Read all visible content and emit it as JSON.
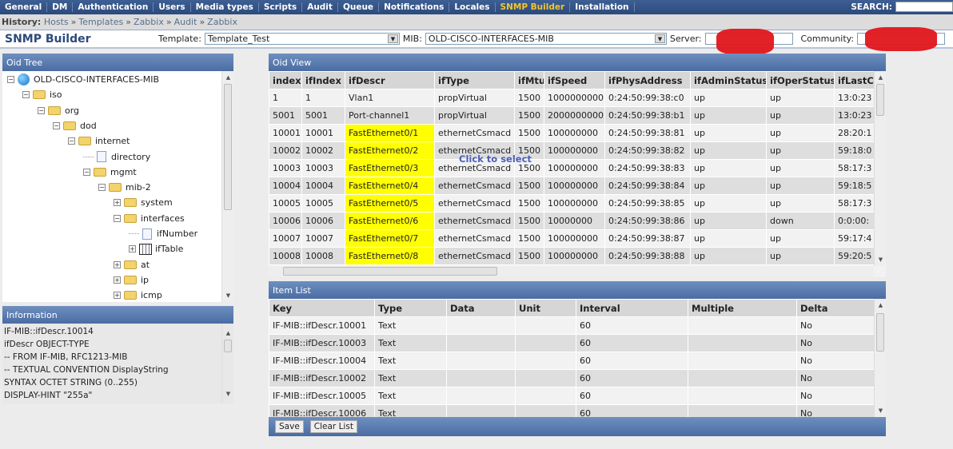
{
  "nav": {
    "items": [
      "General",
      "DM",
      "Authentication",
      "Users",
      "Media types",
      "Scripts",
      "Audit",
      "Queue",
      "Notifications",
      "Locales",
      "SNMP Builder",
      "Installation"
    ],
    "active": "SNMP Builder",
    "search_label": "SEARCH:"
  },
  "history": {
    "label": "History:",
    "crumbs": [
      "Hosts",
      "Templates",
      "Zabbix",
      "Audit",
      "Zabbix"
    ],
    "sep": "»"
  },
  "builder": {
    "title": "SNMP Builder",
    "template_label": "Template:",
    "template_value": "Template_Test",
    "mib_label": "MIB:",
    "mib_value": "OLD-CISCO-INTERFACES-MIB",
    "server_label": "Server:",
    "community_label": "Community:"
  },
  "oid_tree": {
    "title": "Oid Tree",
    "nodes": [
      {
        "label": "OLD-CISCO-INTERFACES-MIB",
        "icon": "globe",
        "exp": "-",
        "depth": 0
      },
      {
        "label": "iso",
        "icon": "folder",
        "exp": "-",
        "depth": 1
      },
      {
        "label": "org",
        "icon": "folder",
        "exp": "-",
        "depth": 2
      },
      {
        "label": "dod",
        "icon": "folder",
        "exp": "-",
        "depth": 3
      },
      {
        "label": "internet",
        "icon": "folder",
        "exp": "-",
        "depth": 4
      },
      {
        "label": "directory",
        "icon": "doc",
        "exp": "",
        "depth": 5
      },
      {
        "label": "mgmt",
        "icon": "folder",
        "exp": "-",
        "depth": 5
      },
      {
        "label": "mib-2",
        "icon": "folder",
        "exp": "-",
        "depth": 6
      },
      {
        "label": "system",
        "icon": "folder",
        "exp": "+",
        "depth": 7
      },
      {
        "label": "interfaces",
        "icon": "folder",
        "exp": "-",
        "depth": 7
      },
      {
        "label": "ifNumber",
        "icon": "doc",
        "exp": "",
        "depth": 8
      },
      {
        "label": "ifTable",
        "icon": "table",
        "exp": "+",
        "depth": 8
      },
      {
        "label": "at",
        "icon": "folder",
        "exp": "+",
        "depth": 7
      },
      {
        "label": "ip",
        "icon": "folder",
        "exp": "+",
        "depth": 7
      },
      {
        "label": "icmp",
        "icon": "folder",
        "exp": "+",
        "depth": 7
      }
    ]
  },
  "information": {
    "title": "Information",
    "lines": [
      "IF-MIB::ifDescr.10014",
      "ifDescr OBJECT-TYPE",
      "-- FROM IF-MIB, RFC1213-MIB",
      "-- TEXTUAL CONVENTION DisplayString",
      "SYNTAX OCTET STRING (0..255)",
      "DISPLAY-HINT \"255a\""
    ]
  },
  "oid_view": {
    "title": "Oid View",
    "tooltip": "Click to select",
    "columns": [
      "index",
      "ifIndex",
      "ifDescr",
      "ifType",
      "ifMtu",
      "ifSpeed",
      "ifPhysAddress",
      "ifAdminStatus",
      "ifOperStatus",
      "ifLastCl"
    ],
    "rows": [
      [
        "1",
        "1",
        "Vlan1",
        "propVirtual",
        "1500",
        "1000000000",
        "0:24:50:99:38:c0",
        "up",
        "up",
        "13:0:23"
      ],
      [
        "5001",
        "5001",
        "Port-channel1",
        "propVirtual",
        "1500",
        "2000000000",
        "0:24:50:99:38:b1",
        "up",
        "up",
        "13:0:23"
      ],
      [
        "10001",
        "10001",
        "FastEthernet0/1",
        "ethernetCsmacd",
        "1500",
        "100000000",
        "0:24:50:99:38:81",
        "up",
        "up",
        "28:20:1"
      ],
      [
        "10002",
        "10002",
        "FastEthernet0/2",
        "ethernetCsmacd",
        "1500",
        "100000000",
        "0:24:50:99:38:82",
        "up",
        "up",
        "59:18:0"
      ],
      [
        "10003",
        "10003",
        "FastEthernet0/3",
        "ethernetCsmacd",
        "1500",
        "100000000",
        "0:24:50:99:38:83",
        "up",
        "up",
        "58:17:3"
      ],
      [
        "10004",
        "10004",
        "FastEthernet0/4",
        "ethernetCsmacd",
        "1500",
        "100000000",
        "0:24:50:99:38:84",
        "up",
        "up",
        "59:18:5"
      ],
      [
        "10005",
        "10005",
        "FastEthernet0/5",
        "ethernetCsmacd",
        "1500",
        "100000000",
        "0:24:50:99:38:85",
        "up",
        "up",
        "58:17:3"
      ],
      [
        "10006",
        "10006",
        "FastEthernet0/6",
        "ethernetCsmacd",
        "1500",
        "10000000",
        "0:24:50:99:38:86",
        "up",
        "down",
        "0:0:00:"
      ],
      [
        "10007",
        "10007",
        "FastEthernet0/7",
        "ethernetCsmacd",
        "1500",
        "100000000",
        "0:24:50:99:38:87",
        "up",
        "up",
        "59:17:4"
      ],
      [
        "10008",
        "10008",
        "FastEthernet0/8",
        "ethernetCsmacd",
        "1500",
        "100000000",
        "0:24:50:99:38:88",
        "up",
        "up",
        "59:20:5"
      ]
    ],
    "highlight_color": "#ffff00"
  },
  "item_list": {
    "title": "Item List",
    "columns": [
      "Key",
      "Type",
      "Data",
      "Unit",
      "Interval",
      "Multiple",
      "Delta"
    ],
    "rows": [
      [
        "IF-MIB::ifDescr.10001",
        "Text",
        "",
        "",
        "60",
        "",
        "No"
      ],
      [
        "IF-MIB::ifDescr.10003",
        "Text",
        "",
        "",
        "60",
        "",
        "No"
      ],
      [
        "IF-MIB::ifDescr.10004",
        "Text",
        "",
        "",
        "60",
        "",
        "No"
      ],
      [
        "IF-MIB::ifDescr.10002",
        "Text",
        "",
        "",
        "60",
        "",
        "No"
      ],
      [
        "IF-MIB::ifDescr.10005",
        "Text",
        "",
        "",
        "60",
        "",
        "No"
      ],
      [
        "IF-MIB::ifDescr.10006",
        "Text",
        "",
        "",
        "60",
        "",
        "No"
      ]
    ],
    "save_label": "Save",
    "clear_label": "Clear List"
  }
}
